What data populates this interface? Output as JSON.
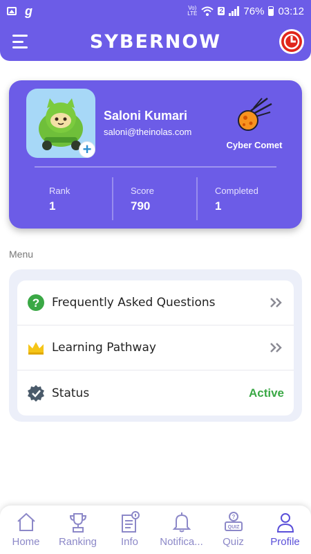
{
  "status_bar": {
    "carrier_small": "Vo) LTE",
    "sim": "2",
    "battery": "76%",
    "time": "03:12"
  },
  "app_bar": {
    "title": "SYBERNOW",
    "menu_icon": "hamburger-menu-icon",
    "logo_icon": "red-round-logo-icon"
  },
  "profile": {
    "name": "Saloni Kumari",
    "email": "saloni@theinolas.com",
    "avatar": "cat-on-scooter-avatar",
    "add_label": "+",
    "badge": {
      "icon": "comet-icon",
      "label": "Cyber Comet"
    },
    "stats": [
      {
        "label": "Rank",
        "value": "1"
      },
      {
        "label": "Score",
        "value": "790"
      },
      {
        "label": "Completed",
        "value": "1"
      }
    ]
  },
  "menu": {
    "heading": "Menu",
    "items": [
      {
        "label": "Frequently Asked Questions",
        "icon": "question-circle-icon"
      },
      {
        "label": "Learning Pathway",
        "icon": "crown-icon"
      },
      {
        "label": "Status",
        "icon": "verified-badge-icon",
        "value": "Active"
      }
    ]
  },
  "bottom_nav": {
    "items": [
      {
        "label": "Home",
        "icon": "home-icon"
      },
      {
        "label": "Ranking",
        "icon": "trophy-icon"
      },
      {
        "label": "Info",
        "icon": "info-document-icon"
      },
      {
        "label": "Notifica...",
        "icon": "bell-icon"
      },
      {
        "label": "Quiz",
        "icon": "quiz-icon"
      },
      {
        "label": "Profile",
        "icon": "person-icon"
      }
    ],
    "active": "Profile"
  },
  "colors": {
    "primary": "#6c5ce7",
    "active_green": "#3aa845",
    "nav_inactive": "#8c88c8",
    "logo_red": "#e0261b"
  }
}
